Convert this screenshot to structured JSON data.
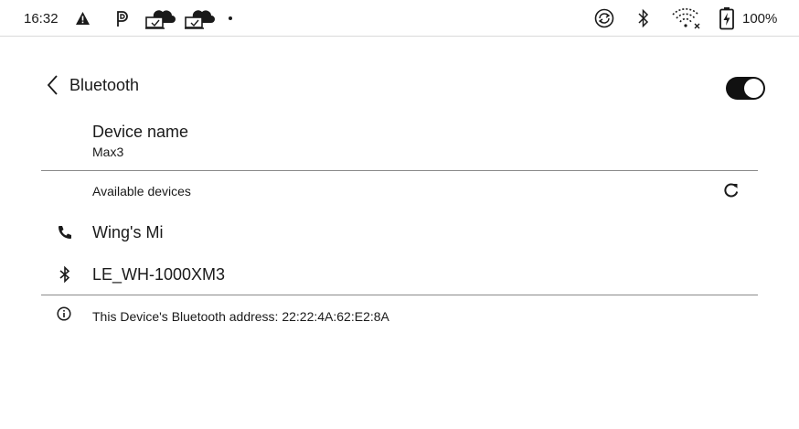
{
  "status_bar": {
    "time": "16:32",
    "battery_percent": "100%",
    "icons": [
      "warning-icon",
      "p-app-icon",
      "cloud-sync-icon",
      "cloud-sync-icon",
      "dot-icon",
      "sync-icon",
      "bluetooth-icon",
      "wifi-icon",
      "battery-charging-icon"
    ]
  },
  "header": {
    "title": "Bluetooth",
    "bluetooth_enabled": true
  },
  "device_name": {
    "label": "Device name",
    "value": "Max3"
  },
  "available_devices": {
    "header": "Available devices",
    "devices": [
      {
        "name": "Wing's Mi",
        "icon": "phone-icon"
      },
      {
        "name": "LE_WH-1000XM3",
        "icon": "bluetooth-icon"
      }
    ]
  },
  "info": {
    "text": "This Device's Bluetooth address: 22:22:4A:62:E2:8A"
  },
  "colors": {
    "text": "#1a1a1a",
    "toggle_on": "#111111",
    "divider": "#8a8a8a"
  }
}
